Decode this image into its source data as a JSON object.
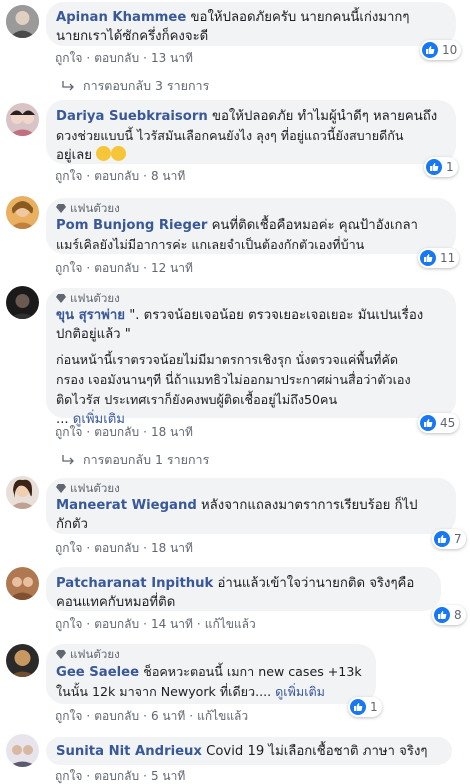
{
  "labels": {
    "like": "ถูกใจ",
    "reply": "ตอบกลับ",
    "edited": "แก้ไขแล้ว",
    "see_more": "ดูเพิ่มเติม",
    "fan": "แฟนตัวยง"
  },
  "colors": {
    "name": "#385898",
    "bubble": "#f2f3f5",
    "like_blue": "#1877f2",
    "meta": "#606770"
  },
  "comments": [
    {
      "name": "Apinan Khammee",
      "lines": [
        "ขอให้ปลอดภัยครับ นายกคนนี้เก่งมากๆ",
        "นายกเราได้ซักครึ่งก็คงจะดี"
      ],
      "time": "13 นาที",
      "likes": "10",
      "replies_label": "การตอบกลับ 3 รายการ"
    },
    {
      "name": "Dariya Suebkraisorn",
      "lines": [
        "ขอให้ปลอดภัย ทำไมผู้นำดีๆ หลายคนถึง",
        "ดวงช่วยแบบนี้ ไวรัสมันเลือกคนยังไง ลุงๆ ที่อยู่แถวนี้ยังสบายดีกัน",
        "อยู่เลย"
      ],
      "time": "8 นาที",
      "likes": "1"
    },
    {
      "name": "Pom Bunjong Rieger",
      "lines": [
        "คนที่ติดเชื้อคือหมอค่ะ คุณป้าอังเกลา",
        "แมร์เคิลยังไม่มีอาการค่ะ แกเลยจำเป็นต้องกักตัวเองที่บ้าน"
      ],
      "time": "12 นาที",
      "likes": "11"
    },
    {
      "name": "ขุน สุราพ่าย",
      "lines": [
        "\". ตรวจน้อยเจอน้อย ตรวจเยอะเจอเยอะ มันเปนเรื่อง",
        "ปกติอยู่แล้ว \"",
        "",
        "ก่อนหน้านี้เราตรวจน้อยไม่มีมาตรการเชิงรุก นั่งตรวจแค่พื้นที่คัด",
        "กรอง เจอมังนานๆที นี่ถ้าแมทธิวไม่ออกมาประกาศผ่านสื่อว่าตัวเอง",
        "ติดไวรัส ประเทศเราก็ยังคงพบผู้ติดเชื้ออยู่ไม่ถึง50คน"
      ],
      "more_prefix": "... ",
      "time": "18 นาที",
      "likes": "45",
      "replies_label": "การตอบกลับ 1 รายการ"
    },
    {
      "name": "Maneerat Wiegand",
      "lines": [
        "หลังจากแถลงมาตราการเรียบร้อย ก็ไป",
        "กักตัว"
      ],
      "time": "18 นาที",
      "likes": "7"
    },
    {
      "name": "Patcharanat Inpithuk",
      "lines": [
        "อ่านแล้วเข้าใจว่านายกติด จริงๆคือ",
        "คอนแทคกับหมอที่ติด"
      ],
      "time": "14 นาที",
      "likes": "8"
    },
    {
      "name": "Gee Saelee",
      "lines": [
        "ช็อคหวะตอนนี้ เมกา new cases +13k",
        "ในนั้น 12k มาจาก Newyork ที่เดียว.... "
      ],
      "time": "6 นาที",
      "likes": "1"
    },
    {
      "name": "Sunita Nit Andrieux",
      "lines": [
        "Covid 19 ไม่เลือกเชื้อชาติ ภาษา จริงๆ"
      ],
      "time": "5 นาที"
    }
  ]
}
